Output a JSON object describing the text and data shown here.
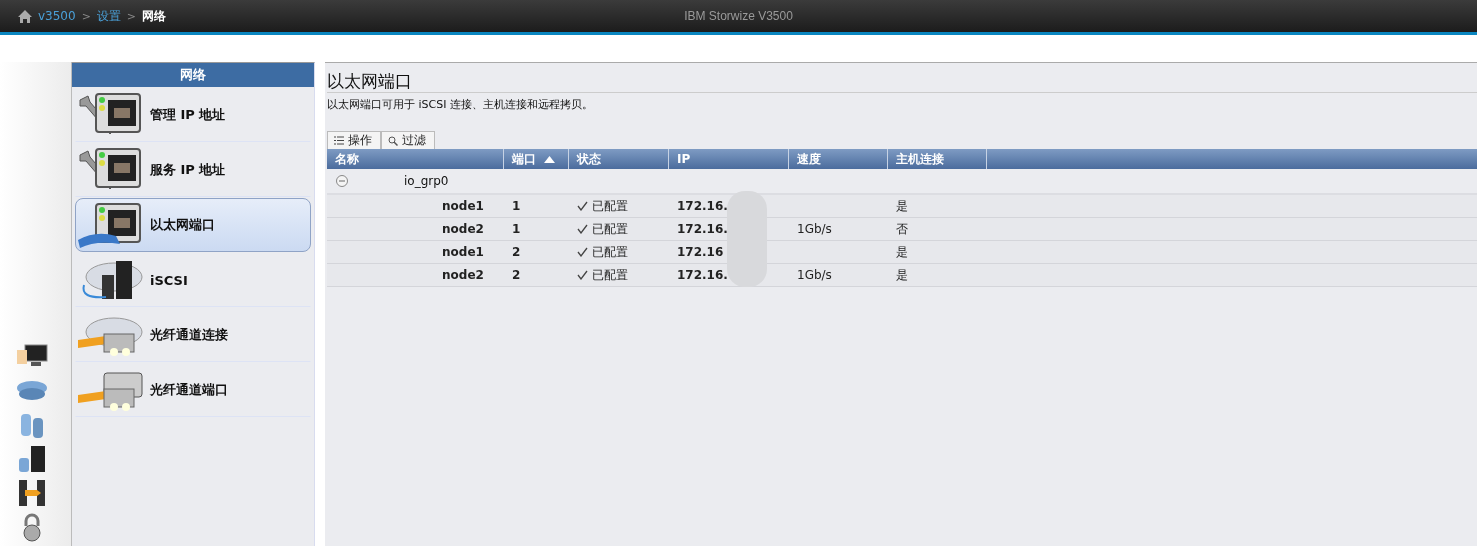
{
  "header": {
    "breadcrumb": [
      {
        "label": "v3500",
        "current": false
      },
      {
        "label": "设置",
        "current": false
      },
      {
        "label": "网络",
        "current": true
      }
    ],
    "separator": ">",
    "product": "IBM Storwize V3500"
  },
  "nav_panel": {
    "title": "网络",
    "items": [
      {
        "label": "管理 IP 地址",
        "selected": false
      },
      {
        "label": "服务 IP 地址",
        "selected": false
      },
      {
        "label": "以太网端口",
        "selected": true
      },
      {
        "label": "iSCSI",
        "selected": false
      },
      {
        "label": "光纤通道连接",
        "selected": false
      },
      {
        "label": "光纤通道端口",
        "selected": false
      }
    ]
  },
  "content": {
    "title": "以太网端口",
    "description": "以太网端口可用于 iSCSI 连接、主机连接和远程拷贝。",
    "toolbar": [
      {
        "label": "操作"
      },
      {
        "label": "过滤"
      }
    ],
    "table": {
      "columns": [
        {
          "label": "名称",
          "sorted": false
        },
        {
          "label": "端口",
          "sorted": true
        },
        {
          "label": "状态",
          "sorted": false
        },
        {
          "label": "IP",
          "sorted": false
        },
        {
          "label": "速度",
          "sorted": false
        },
        {
          "label": "主机连接",
          "sorted": false
        }
      ],
      "groups": [
        {
          "label": "io_grp0",
          "expanded": true,
          "rows": [
            {
              "name": "node1",
              "port": "1",
              "configured": true,
              "status": "已配置",
              "ip": "172.16.",
              "speed": "",
              "host": "是"
            },
            {
              "name": "node2",
              "port": "1",
              "configured": true,
              "status": "已配置",
              "ip": "172.16.",
              "speed": "1Gb/s",
              "host": "否"
            },
            {
              "name": "node1",
              "port": "2",
              "configured": true,
              "status": "已配置",
              "ip": "172.16",
              "speed": "",
              "host": "是"
            },
            {
              "name": "node2",
              "port": "2",
              "configured": true,
              "status": "已配置",
              "ip": "172.16.",
              "speed": "1Gb/s",
              "host": "是"
            }
          ]
        }
      ]
    }
  }
}
